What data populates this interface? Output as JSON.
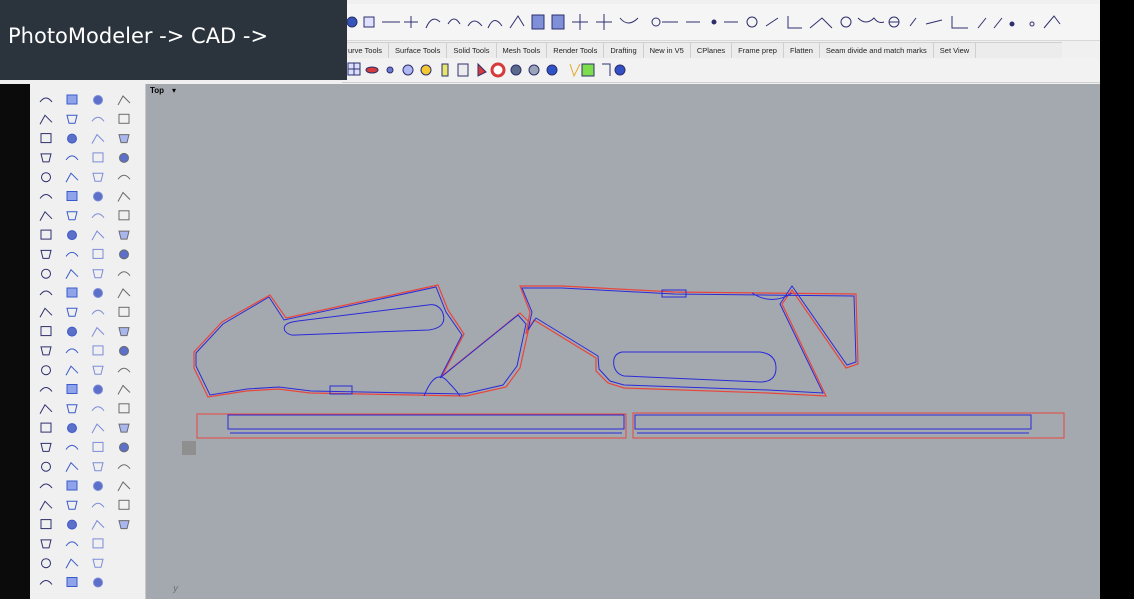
{
  "caption": "PhotoModeler -> CAD ->",
  "tabs": [
    "urve Tools",
    "Surface Tools",
    "Solid Tools",
    "Mesh Tools",
    "Render Tools",
    "Drafting",
    "New in V5",
    "CPlanes",
    "Frame prep",
    "Flatten",
    "Seam divide and match marks",
    "Set View"
  ],
  "viewport": {
    "name": "Top",
    "menu_glyph": "▾",
    "axis": "y"
  },
  "colors": {
    "curve_blue": "#2a2ad8",
    "outline_red": "#e8463c",
    "viewport_bg": "#a4a9b0"
  },
  "icons": {
    "left_palette": "rhino-command-icons",
    "top_toolbar": "rhino-command-icons"
  }
}
